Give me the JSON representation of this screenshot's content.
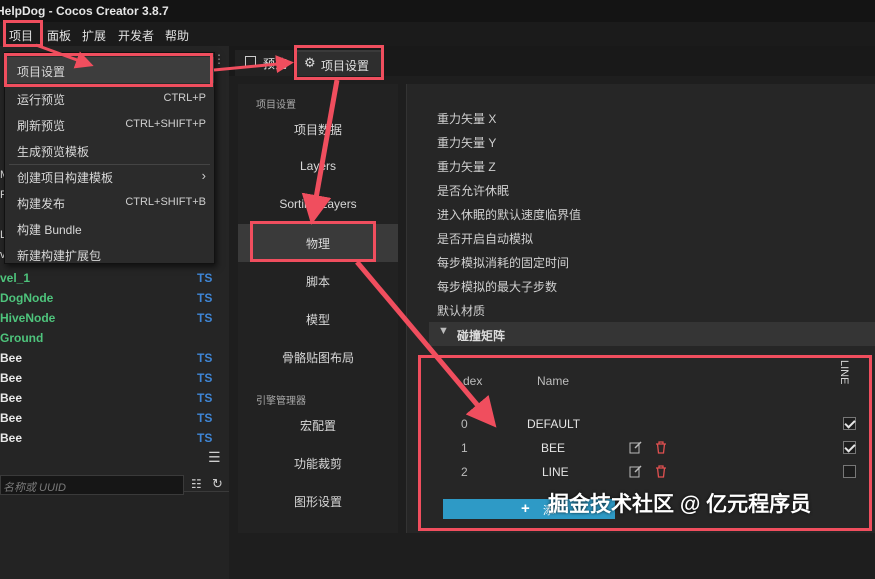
{
  "window": {
    "title": "HelpDog - Cocos Creator 3.8.7"
  },
  "menubar": {
    "items": [
      "项目",
      "面板",
      "扩展",
      "开发者",
      "帮助"
    ]
  },
  "dropdown": {
    "items": [
      {
        "label": "项目设置",
        "shortcut": ""
      },
      {
        "label": "运行预览",
        "shortcut": "CTRL+P"
      },
      {
        "label": "刷新预览",
        "shortcut": "CTRL+SHIFT+P"
      },
      {
        "label": "生成预览模板",
        "shortcut": ""
      },
      {
        "label": "创建项目构建模板",
        "shortcut": ""
      },
      {
        "label": "构建发布",
        "shortcut": "CTRL+SHIFT+B"
      },
      {
        "label": "构建 Bundle",
        "shortcut": ""
      },
      {
        "label": "新建构建扩展包",
        "shortcut": ""
      }
    ]
  },
  "assets": {
    "rows": [
      {
        "name": "vel_1",
        "type": "TS",
        "color": "#4ec47c"
      },
      {
        "name": "DogNode",
        "type": "TS",
        "color": "#4ec47c"
      },
      {
        "name": "HiveNode",
        "type": "TS",
        "color": "#4ec47c"
      },
      {
        "name": "Ground",
        "type": "",
        "color": "#4ec47c"
      },
      {
        "name": "Bee",
        "type": "TS",
        "color": "#e8e8e8"
      },
      {
        "name": "Bee",
        "type": "TS",
        "color": "#e8e8e8"
      },
      {
        "name": "Bee",
        "type": "TS",
        "color": "#e8e8e8"
      },
      {
        "name": "Bee",
        "type": "TS",
        "color": "#e8e8e8"
      },
      {
        "name": "Bee",
        "type": "TS",
        "color": "#e8e8e8"
      }
    ],
    "search_placeholder": "名称或 UUID",
    "side_letters": [
      "M",
      "F",
      "L",
      "v"
    ]
  },
  "tabs": [
    {
      "label": "预览",
      "icon": "preview-icon"
    },
    {
      "label": "项目设置",
      "icon": "gear-icon"
    }
  ],
  "settings_nav": {
    "section1": "项目设置",
    "items1": [
      "项目数据",
      "Layers",
      "Sorting Layers",
      "物理",
      "脚本",
      "模型",
      "骨骼贴图布局"
    ],
    "section2": "引擎管理器",
    "items2": [
      "宏配置",
      "功能裁剪",
      "图形设置"
    ]
  },
  "physics": {
    "props": [
      "重力矢量 X",
      "重力矢量 Y",
      "重力矢量 Z",
      "是否允许休眠",
      "进入休眠的默认速度临界值",
      "是否开启自动模拟",
      "每步模拟消耗的固定时间",
      "每步模拟的最大子步数",
      "默认材质"
    ],
    "collision_header": "碰撞矩阵",
    "matrix": {
      "col_index": "dex",
      "col_name": "Name",
      "col_line": "LINE",
      "rows": [
        {
          "index": "0",
          "name": "DEFAULT",
          "checked": true,
          "editable": false
        },
        {
          "index": "1",
          "name": "BEE",
          "checked": true,
          "editable": true
        },
        {
          "index": "2",
          "name": "LINE",
          "checked": false,
          "editable": true
        }
      ],
      "add_label": "添"
    }
  },
  "watermark": "掘金技术社区 @ 亿元程序员",
  "colors": {
    "accent": "#2e9ac6",
    "annotation": "#f04e5e",
    "ts_badge": "#3f86d6"
  }
}
